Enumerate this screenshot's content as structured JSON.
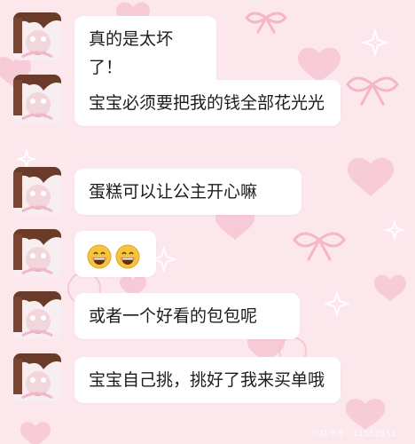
{
  "colors": {
    "background": "#fbe7ec",
    "bubble": "#ffffff",
    "text": "#1c1c1c",
    "heart": "#f7c9d6",
    "ribbon": "#f4b6c8"
  },
  "messages": [
    {
      "text": "真的是太坏了！"
    },
    {
      "text": "宝宝必须要把我的钱全部花光光"
    },
    {
      "text": "蛋糕可以让公主开心嘛"
    },
    {
      "emojis": [
        "grinning-face-emoji",
        "grinning-face-emoji"
      ]
    },
    {
      "text": "或者一个好看的包包呢"
    },
    {
      "text": "宝宝自己挑，挑好了我来买单哦"
    }
  ],
  "watermark": "小红书号：11552832..."
}
